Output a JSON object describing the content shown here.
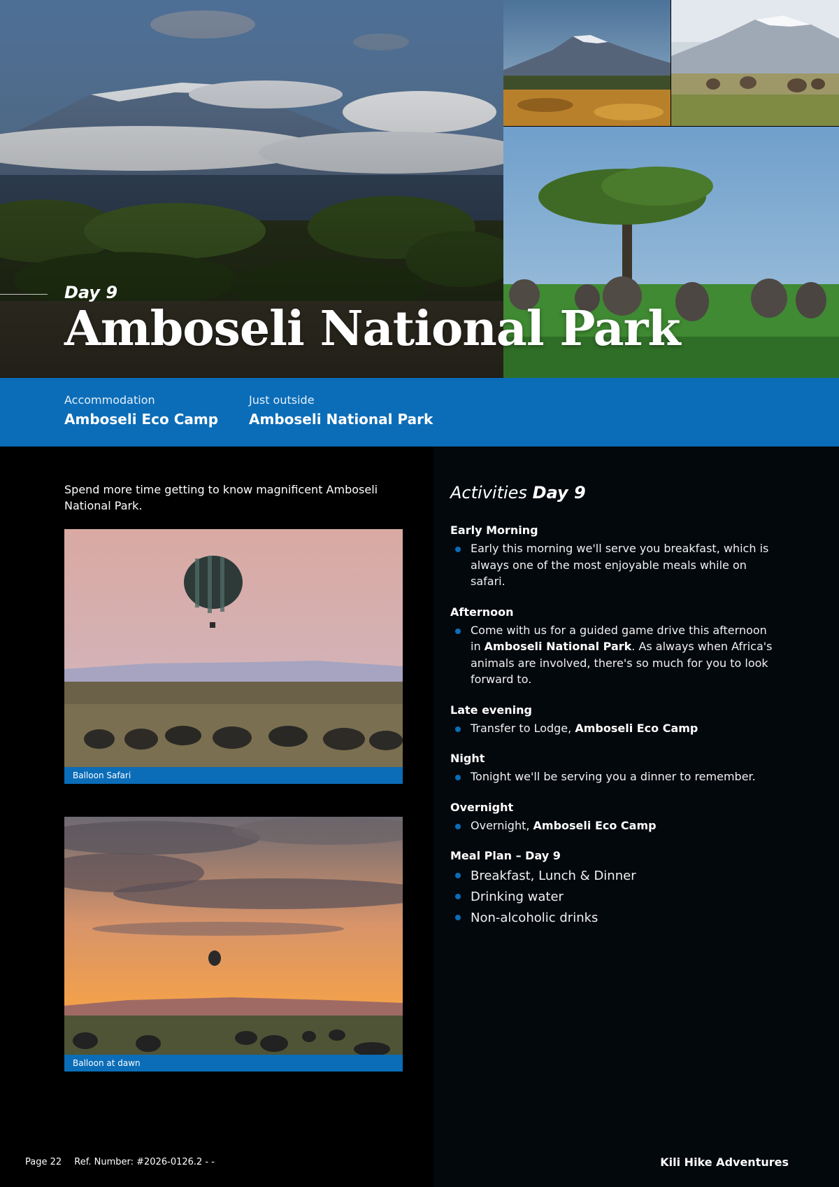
{
  "hero": {
    "day_label": "Day 9",
    "title": "Amboseli National Park"
  },
  "info_band": {
    "accommodation_label": "Accommodation",
    "accommodation_value": "Amboseli Eco Camp",
    "location_label": "Just outside",
    "location_value": "Amboseli National Park"
  },
  "intro": "Spend more time getting to know magnificent Amboseli National Park.",
  "figures": [
    {
      "caption": "Balloon Safari"
    },
    {
      "caption": "Balloon at dawn"
    }
  ],
  "activities": {
    "title_prefix": "Activities",
    "title_day": "Day 9",
    "early_morning": {
      "heading": "Early Morning",
      "text": "Early this morning we'll serve you breakfast, which is always one of the most enjoyable meals while on safari."
    },
    "afternoon": {
      "heading": "Afternoon",
      "text_before": "Come with us for a guided game drive this afternoon in ",
      "text_bold": "Amboseli National Park",
      "text_after": ". As always when Africa's animals are involved, there's so much for you to look forward to."
    },
    "late_evening": {
      "heading": "Late evening",
      "text_before": "Transfer to Lodge, ",
      "text_bold": "Amboseli Eco Camp"
    },
    "night": {
      "heading": "Night",
      "text": "Tonight we'll be serving you a dinner to remember."
    },
    "overnight": {
      "heading": "Overnight",
      "text_before": "Overnight, ",
      "text_bold": "Amboseli Eco Camp"
    },
    "meal_plan": {
      "heading": "Meal Plan – Day 9",
      "items": [
        "Breakfast, Lunch & Dinner",
        "Drinking water",
        "Non-alcoholic drinks"
      ]
    }
  },
  "footer": {
    "page": "Page 22",
    "ref": "Ref. Number: #2026-0126.2 - -",
    "brand": "Kili Hike Adventures"
  },
  "colors": {
    "accent_blue": "#0b6db8",
    "right_panel": "#03080d"
  }
}
